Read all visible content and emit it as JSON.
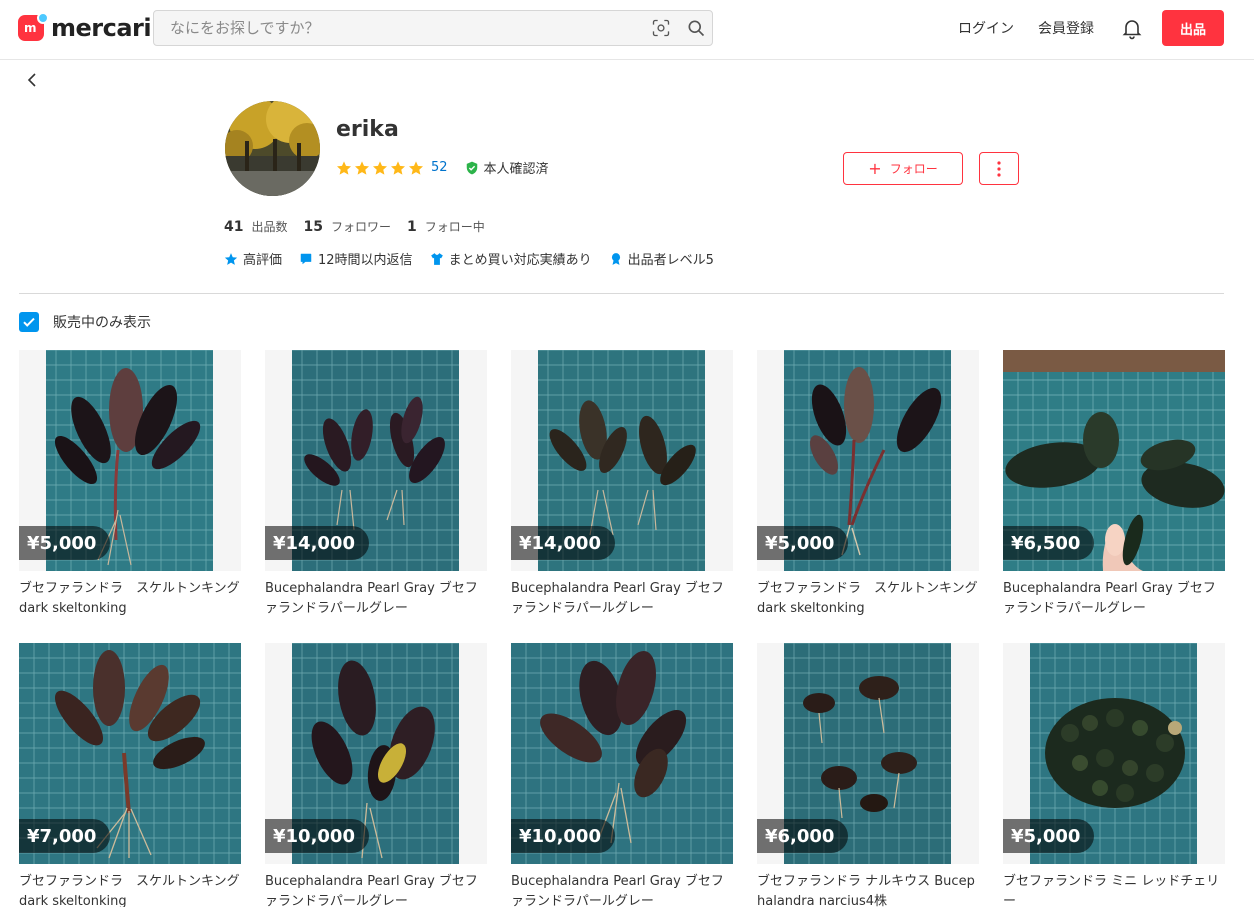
{
  "header": {
    "logo_text": "mercari",
    "logo_mark": "m",
    "search_placeholder": "なにをお探しですか？",
    "login_label": "ログイン",
    "register_label": "会員登録",
    "sell_label": "出品"
  },
  "profile": {
    "name": "erika",
    "rating_stars": 5,
    "rating_count": "52",
    "verified_label": "本人確認済",
    "follow_label": "フォロー",
    "stats": [
      {
        "value": "41",
        "label": "出品数"
      },
      {
        "value": "15",
        "label": "フォロワー"
      },
      {
        "value": "1",
        "label": "フォロー中"
      }
    ],
    "badges": [
      {
        "icon": "star-badge-icon",
        "label": "高評価"
      },
      {
        "icon": "chat-badge-icon",
        "label": "12時間以内返信"
      },
      {
        "icon": "shirt-badge-icon",
        "label": "まとめ買い対応実績あり"
      },
      {
        "icon": "medal-badge-icon",
        "label": "出品者レベル5"
      }
    ]
  },
  "filter": {
    "label": "販売中のみ表示",
    "checked": true
  },
  "items": [
    {
      "price": "¥5,000",
      "name": "ブセファランドラ　スケルトンキング　dark skeltonking"
    },
    {
      "price": "¥14,000",
      "name": "Bucephalandra Pearl Gray ブセファランドラパールグレー"
    },
    {
      "price": "¥14,000",
      "name": "Bucephalandra Pearl Gray ブセファランドラパールグレー"
    },
    {
      "price": "¥5,000",
      "name": "ブセファランドラ　スケルトンキング　dark skeltonking"
    },
    {
      "price": "¥6,500",
      "name": "Bucephalandra Pearl Gray ブセファランドラパールグレー"
    },
    {
      "price": "¥7,000",
      "name": "ブセファランドラ　スケルトンキング　dark skeltonking"
    },
    {
      "price": "¥10,000",
      "name": "Bucephalandra Pearl Gray ブセファランドラパールグレー"
    },
    {
      "price": "¥10,000",
      "name": "Bucephalandra Pearl Gray ブセファランドラパールグレー"
    },
    {
      "price": "¥6,000",
      "name": "ブセファランドラ ナルキウス Bucephalandra narcius4株"
    },
    {
      "price": "¥5,000",
      "name": "ブセファランドラ ミニ レッドチェリー"
    }
  ],
  "colors": {
    "brand_red": "#ff333f",
    "link_blue": "#0073cc",
    "checkbox_blue": "#0095ee",
    "star_yellow": "#ffb818",
    "verified_green": "#2cb34a"
  }
}
